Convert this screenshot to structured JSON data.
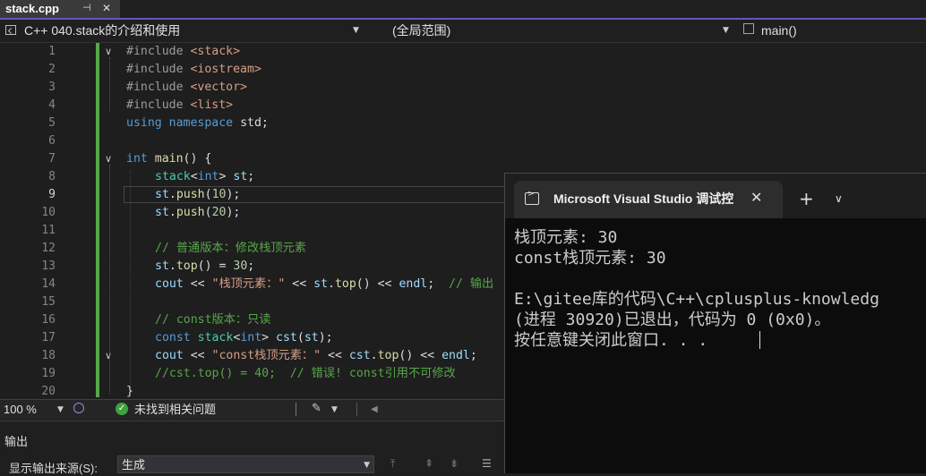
{
  "tab": {
    "title": "stack.cpp",
    "pin_icon": "pin-icon",
    "close_glyph": "✕"
  },
  "navbar": {
    "project": "C++ 040.stack的介绍和使用",
    "scope": "(全局范围)",
    "member": "main()"
  },
  "editor": {
    "line_numbers": [
      "1",
      "2",
      "3",
      "4",
      "5",
      "6",
      "7",
      "8",
      "9",
      "10",
      "11",
      "12",
      "13",
      "14",
      "15",
      "16",
      "17",
      "18",
      "19",
      "20"
    ],
    "fold_glyph": "∨",
    "code": {
      "l1": {
        "directive": "#include",
        "file": "<stack>"
      },
      "l2": {
        "directive": "#include",
        "file": "<iostream>"
      },
      "l3": {
        "directive": "#include",
        "file": "<vector>"
      },
      "l4": {
        "directive": "#include",
        "file": "<list>"
      },
      "l5": {
        "using": "using",
        "namespace": "namespace",
        "std": "std",
        "semi": ";"
      },
      "l7": {
        "int": "int",
        "main": "main",
        "rest": "() {"
      },
      "l8": {
        "stack": "stack",
        "lt": "<",
        "int": "int",
        "gt": ">",
        "st": "st",
        "semi": ";"
      },
      "l9": {
        "st": "st",
        "push": "push",
        "open": "(",
        "num": "10",
        "close": ");"
      },
      "l10": {
        "st": "st",
        "push": "push",
        "open": "(",
        "num": "20",
        "close": ");"
      },
      "l12": "// 普通版本：修改栈顶元素",
      "l13": {
        "st": "st",
        "top": "top",
        "mid": "() = ",
        "num": "30",
        "semi": ";"
      },
      "l14": {
        "cout": "cout",
        "op1": " << ",
        "str": "\"栈顶元素：\"",
        "op2": " << ",
        "st": "st",
        "top": "top",
        "op3": "() << ",
        "endl": "endl",
        "semi": ";  ",
        "comment": "// 输出"
      },
      "l16": "// const版本：只读",
      "l17": {
        "const": "const",
        "stack": "stack",
        "lt": "<",
        "int": "int",
        "gt": ">",
        "cst": "cst",
        "open": "(",
        "st": "st",
        "close": ");"
      },
      "l18": {
        "cout": "cout",
        "op1": " << ",
        "str": "\"const栈顶元素：\"",
        "op2": " << ",
        "cst": "cst",
        "top": "top",
        "op3": "() << ",
        "endl": "endl",
        "semi": ";"
      },
      "l19": "//cst.top() = 40;  // 错误! const引用不可修改",
      "l20": "}"
    }
  },
  "statusbar": {
    "zoom": "100 %",
    "issues": "未找到相关问题"
  },
  "output": {
    "title": "输出",
    "source_label": "显示输出来源(S):",
    "source_value": "生成"
  },
  "console": {
    "title": "Microsoft Visual Studio 调试控",
    "lines": [
      "栈顶元素: 30",
      "const栈顶元素: 30",
      "",
      "E:\\gitee库的代码\\C++\\cplusplus-knowledg",
      "(进程 30920)已退出，代码为 0 (0x0)。",
      "按任意键关闭此窗口. . ."
    ]
  },
  "colors": {
    "accent": "#6b53b8",
    "change_bar": "#57a64a",
    "ok_green": "#3fa23f",
    "console_bg": "#0c0c0c"
  }
}
